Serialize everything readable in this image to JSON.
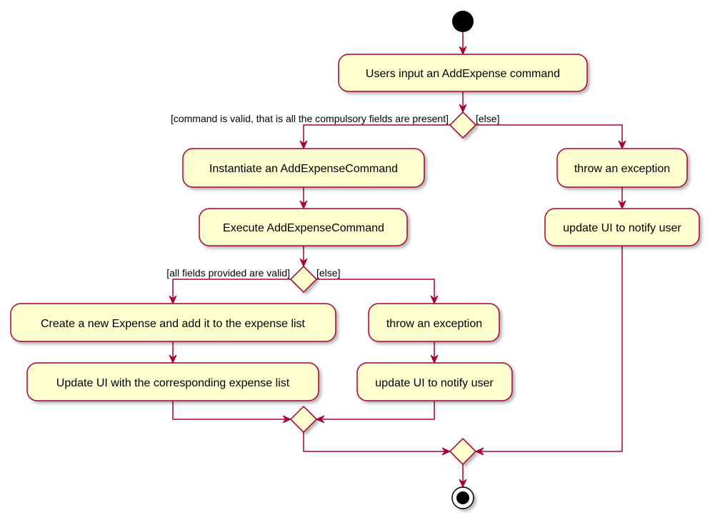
{
  "colors": {
    "node_fill": "#FEFECE",
    "border": "#A80036",
    "start": "#000000"
  },
  "activities": {
    "input": "Users input an AddExpense command",
    "instantiate": "Instantiate an AddExpenseCommand",
    "execute": "Execute AddExpenseCommand",
    "create": "Create a new Expense and add it to the expense list",
    "update_list": "Update UI with the corresponding expense list",
    "throw_inner": "throw an exception",
    "notify_inner": "update UI to notify user",
    "throw_outer": "throw an exception",
    "notify_outer": "update UI to notify user"
  },
  "guards": {
    "outer_yes": "[command is valid, that is all the compulsory fields are present]",
    "outer_else": "[else]",
    "inner_yes": "[all fields provided are valid]",
    "inner_else": "[else]"
  }
}
